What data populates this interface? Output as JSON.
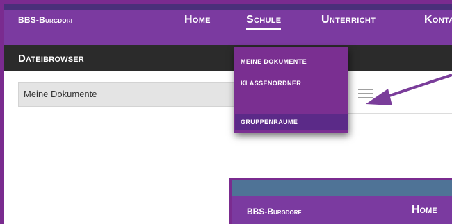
{
  "navbar": {
    "brand": "BBS-Burgdorf",
    "items": [
      "Home",
      "Schule",
      "Unterricht",
      "Kontakt"
    ],
    "active": "Schule"
  },
  "dropdown": {
    "items": [
      "Meine Dokumente",
      "Klassenordner",
      "Gruppenräume"
    ],
    "active": "Gruppenräume"
  },
  "darkbar": {
    "title": "Dateibrowser"
  },
  "left_panel": {
    "folder": "Meine Dokumente"
  },
  "inset": {
    "brand": "BBS-Burgdorf",
    "home": "Home"
  },
  "colors": {
    "nav_purple": "#7b3aa0",
    "border_purple": "#7a2b8f",
    "dark": "#2b2b2b",
    "arrow": "#7a3d9a"
  },
  "icons": {
    "menu": "hamburger-icon",
    "pointer": "arrow-icon"
  }
}
